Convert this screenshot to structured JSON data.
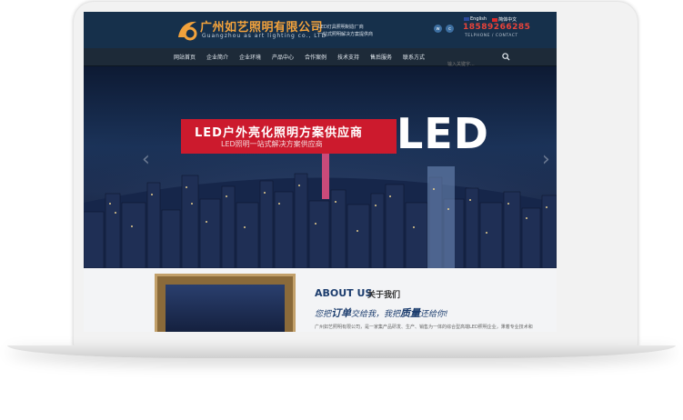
{
  "header": {
    "brand_cn": "广州如艺照明有限公司",
    "brand_en": "Guangzhou as art lighting co., LTD",
    "slogan_line1": "LED灯具照明制造厂商",
    "slogan_line2": "一站式照明解决方案提供商",
    "lang_en": "English",
    "lang_cn": "简体中文",
    "phone": "18589266285",
    "phone_caption": "TELPHONE / CONTACT",
    "icon_1": "weibo-icon",
    "icon_2": "wechat-icon"
  },
  "nav": {
    "items": [
      "网站首页",
      "企业简介",
      "企业环境",
      "产品中心",
      "合作案例",
      "技术支持",
      "售后服务",
      "联系方式"
    ],
    "search_placeholder": "输入关键字..."
  },
  "banner": {
    "headline": "LED户外亮化照明方案供应商",
    "subline": "LED照明一站式解决方案供应商",
    "big_text": "LED",
    "accent_color": "#cc1a2d"
  },
  "about": {
    "title_en": "ABOUT US",
    "title_cn": "关于我们",
    "slogan_pre": "您把",
    "slogan_hl1": "订单",
    "slogan_mid": "交给我，我把",
    "slogan_hl2": "质量",
    "slogan_post": "还给你!",
    "description": "广州如艺照明有限公司，是一家集产品研发、生产、销售为一体的综合型高端LED照明企业，秉着专业技术和"
  }
}
